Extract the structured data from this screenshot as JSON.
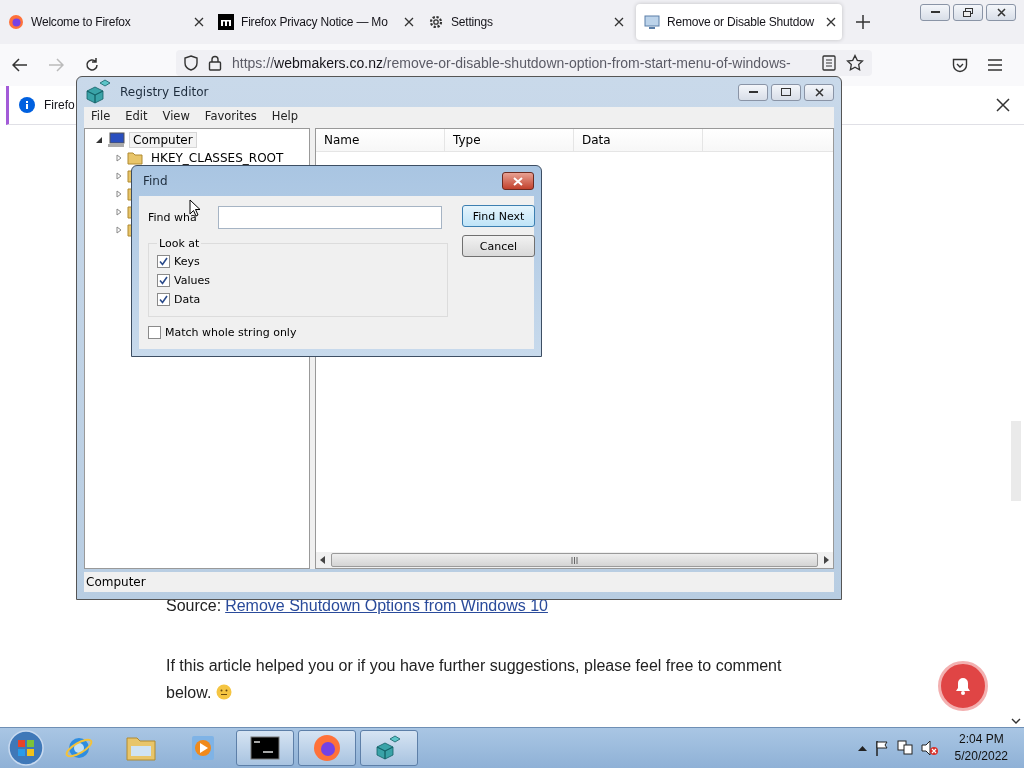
{
  "browser": {
    "tabs": [
      {
        "label": "Welcome to Firefox",
        "selected": false
      },
      {
        "label": "Firefox Privacy Notice — Mo",
        "selected": false
      },
      {
        "label": "Settings",
        "selected": false
      },
      {
        "label": "Remove or Disable Shutdow",
        "selected": true
      }
    ],
    "url": {
      "scheme": "https://",
      "host": "webmakers.co.nz",
      "path": "/remove-or-disable-shutdown-option-from-start-menu-of-windows-"
    },
    "forward_disabled": true,
    "notification": {
      "text": "Firefo"
    },
    "article": {
      "source_label": "Source:",
      "source_link": "Remove Shutdown Options from Windows 10",
      "paragraph": "If this article helped you or if you have further suggestions, please feel free to comment below."
    }
  },
  "registry_editor": {
    "title": "Registry Editor",
    "menu": [
      "File",
      "Edit",
      "View",
      "Favorites",
      "Help"
    ],
    "tree": {
      "label": "Computer",
      "expanded": true,
      "selected": true,
      "children": [
        {
          "label": "HKEY_CLASSES_ROOT",
          "expanded": false
        },
        {
          "expanded": false
        },
        {
          "expanded": false
        },
        {
          "expanded": false
        },
        {
          "expanded": false
        }
      ]
    },
    "columns": [
      "Name",
      "Type",
      "Data"
    ],
    "status_bar": "Computer"
  },
  "find_dialog": {
    "title": "Find",
    "find_what_label": "Find wha",
    "buttons": [
      {
        "label": "Find Next",
        "selected": true
      },
      {
        "label": "Cancel",
        "selected": false
      }
    ],
    "look_at_label": "Look at",
    "options": [
      {
        "label": "Keys",
        "checked": true
      },
      {
        "label": "Values",
        "checked": true
      },
      {
        "label": "Data",
        "checked": true
      }
    ],
    "match_whole": {
      "label": "Match whole string only",
      "checked": false
    }
  },
  "taskbar": {
    "items": [
      {
        "running": false
      },
      {
        "running": false
      },
      {
        "running": false
      },
      {
        "running": true
      },
      {
        "running": true
      },
      {
        "running": true
      }
    ],
    "time": "2:04 PM",
    "date": "5/20/2022"
  }
}
